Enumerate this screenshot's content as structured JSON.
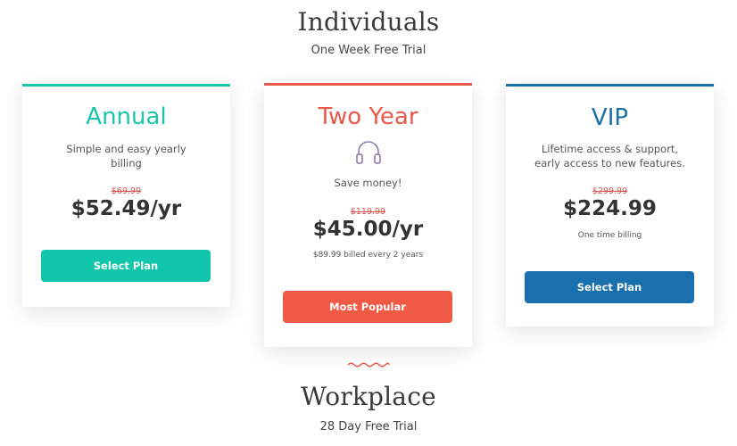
{
  "individuals": {
    "title": "Individuals",
    "subtitle": "One Week Free Trial"
  },
  "plans": [
    {
      "name": "Annual",
      "description_lines": [
        "Simple and easy yearly",
        "billing"
      ],
      "old_price": "$69.99",
      "price": "$52.49/yr",
      "button_label": "Select Plan",
      "accent_color": "#1cc4ab",
      "button_color": "#11c6ab"
    },
    {
      "name": "Two Year",
      "icon": "headphones-icon",
      "description": "Save money!",
      "old_price": "$119.99",
      "price": "$45.00/yr",
      "note": "$89.99 billed every 2 years",
      "button_label": "Most Popular",
      "accent_color": "#e8594a",
      "button_color": "#f05a44",
      "icon_color": "#8e7bb0"
    },
    {
      "name": "VIP",
      "description_lines": [
        "Lifetime access & support,",
        "early access to new features."
      ],
      "old_price": "$299.99",
      "price": "$224.99",
      "note": "One time billing",
      "button_label": "Select Plan",
      "accent_color": "#1a6fa8",
      "button_color": "#1a6fad"
    }
  ],
  "workplace": {
    "title": "Workplace",
    "subtitle": "28 Day Free Trial",
    "divider_icon": "wave-divider-icon",
    "divider_color": "#e8594a"
  }
}
